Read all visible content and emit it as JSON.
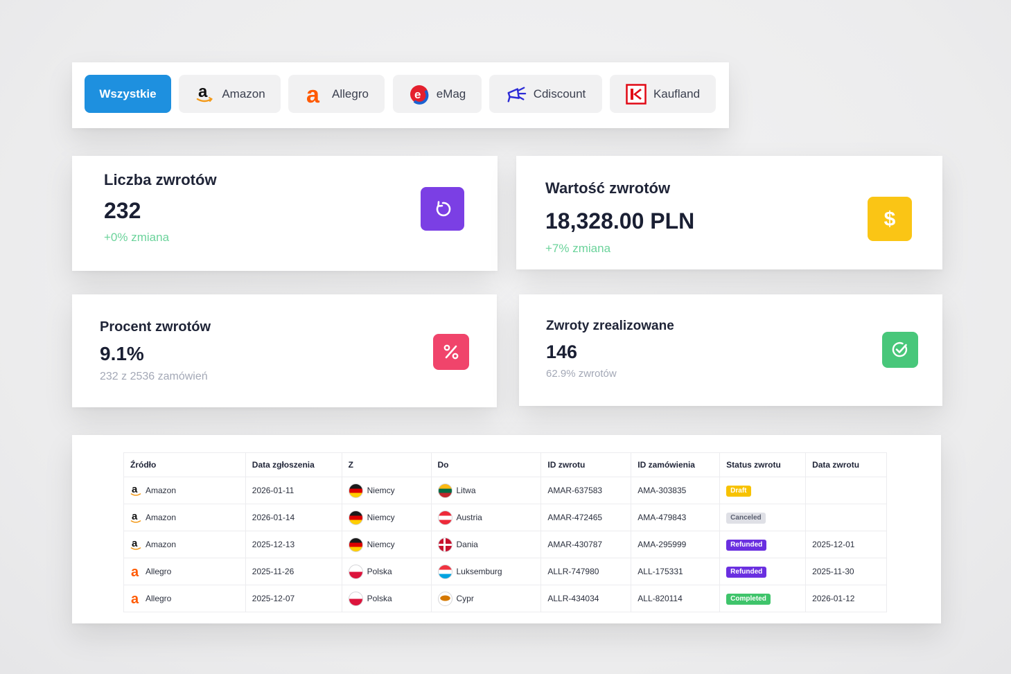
{
  "filters": [
    {
      "label": "Wszystkie",
      "icon": "",
      "active": true
    },
    {
      "label": "Amazon",
      "icon": "amazon-logo-icon",
      "active": false
    },
    {
      "label": "Allegro",
      "icon": "allegro-logo-icon",
      "active": false
    },
    {
      "label": "eMag",
      "icon": "emag-logo-icon",
      "active": false
    },
    {
      "label": "Cdiscount",
      "icon": "cdiscount-logo-icon",
      "active": false
    },
    {
      "label": "Kaufland",
      "icon": "kaufland-logo-icon",
      "active": false
    }
  ],
  "stats": {
    "count": {
      "title": "Liczba zwrotów",
      "value": "232",
      "sub": "+0% zmiana",
      "icon": "refresh-icon",
      "color": "#7b3fe4"
    },
    "value": {
      "title": "Wartość zwrotów",
      "value": "18,328.00 PLN",
      "sub": "+7% zmiana",
      "icon": "dollar-icon",
      "color": "#fac515"
    },
    "percent": {
      "title": "Procent zwrotów",
      "value": "9.1%",
      "sub": "232 z 2536 zamówień",
      "icon": "percent-icon",
      "color": "#f0446b"
    },
    "completed": {
      "title": "Zwroty zrealizowane",
      "value": "146",
      "sub": "62.9% zwrotów",
      "icon": "check-circle-icon",
      "color": "#48c77a"
    }
  },
  "table": {
    "headers": [
      "Źródło",
      "Data zgłoszenia",
      "Z",
      "Do",
      "ID zwrotu",
      "ID zamówienia",
      "Status zwrotu",
      "Data zwrotu"
    ],
    "rows": [
      {
        "source": "Amazon",
        "date": "2026-01-11",
        "from": "Niemcy",
        "to": "Litwa",
        "return_id": "AMAR-637583",
        "order_id": "AMA-303835",
        "status": "Draft",
        "return_date": ""
      },
      {
        "source": "Amazon",
        "date": "2026-01-14",
        "from": "Niemcy",
        "to": "Austria",
        "return_id": "AMAR-472465",
        "order_id": "AMA-479843",
        "status": "Canceled",
        "return_date": ""
      },
      {
        "source": "Amazon",
        "date": "2025-12-13",
        "from": "Niemcy",
        "to": "Dania",
        "return_id": "AMAR-430787",
        "order_id": "AMA-295999",
        "status": "Refunded",
        "return_date": "2025-12-01"
      },
      {
        "source": "Allegro",
        "date": "2025-11-26",
        "from": "Polska",
        "to": "Luksemburg",
        "return_id": "ALLR-747980",
        "order_id": "ALL-175331",
        "status": "Refunded",
        "return_date": "2025-11-30"
      },
      {
        "source": "Allegro",
        "date": "2025-12-07",
        "from": "Polska",
        "to": "Cypr",
        "return_id": "ALLR-434034",
        "order_id": "ALL-820114",
        "status": "Completed",
        "return_date": "2026-01-12"
      }
    ]
  },
  "colors": {
    "accent": "#1e90df",
    "positive": "#6bd39b"
  }
}
